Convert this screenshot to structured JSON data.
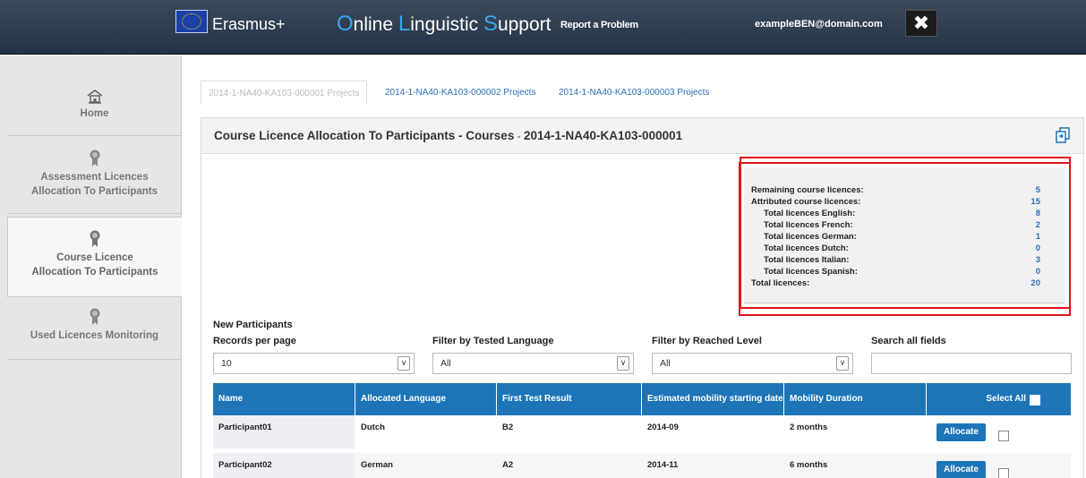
{
  "header": {
    "brand": "Erasmus+",
    "ols_caps": [
      "O",
      "L",
      "S"
    ],
    "ols_rest": [
      "nline ",
      "inguistic ",
      "upport"
    ],
    "report_link": "Report a Problem",
    "user_email": "exampleBEN@domain.com",
    "close_glyph": "✖"
  },
  "sidebar": {
    "items": [
      {
        "label1": "Home",
        "label2": "",
        "icon": "home-icon",
        "active": false
      },
      {
        "label1": "Assessment Licences",
        "label2": "Allocation To Participants",
        "icon": "award-icon",
        "active": false
      },
      {
        "label1": "Course Licence",
        "label2": "Allocation To Participants",
        "icon": "award-icon",
        "active": true
      },
      {
        "label1": "Used Licences Monitoring",
        "label2": "",
        "icon": "award-icon",
        "active": false
      }
    ]
  },
  "tabs": [
    {
      "label": "2014-1-NA40-KA103-000001 Projects",
      "active": true
    },
    {
      "label": "2014-1-NA40-KA103-000002 Projects",
      "active": false
    },
    {
      "label": "2014-1-NA40-KA103-000003 Projects",
      "active": false
    }
  ],
  "panel": {
    "title": "Course Licence Allocation To Participants - Courses",
    "title_sep": " - ",
    "project": "2014-1-NA40-KA103-000001",
    "export_icon": "export-icon"
  },
  "summary": {
    "rows": [
      {
        "label": "Remaining course licences:",
        "value": "5",
        "indent": false
      },
      {
        "label": "Attributed course licences:",
        "value": "15",
        "indent": false
      },
      {
        "label": "Total licences English:",
        "value": "8",
        "indent": true
      },
      {
        "label": "Total licences French:",
        "value": "2",
        "indent": true
      },
      {
        "label": "Total licences German:",
        "value": "1",
        "indent": true
      },
      {
        "label": "Total licences Dutch:",
        "value": "0",
        "indent": true
      },
      {
        "label": "Total licences Italian:",
        "value": "3",
        "indent": true
      },
      {
        "label": "Total licences Spanish:",
        "value": "0",
        "indent": true
      },
      {
        "label": "Total licences:",
        "value": "20",
        "indent": false
      }
    ]
  },
  "filters": {
    "section_title": "New Participants",
    "records_label": "Records per page",
    "records_value": "10",
    "tested_label": "Filter by Tested Language",
    "tested_value": "All",
    "reached_label": "Filter by Reached Level",
    "reached_value": "All",
    "search_label": "Search all fields",
    "search_value": ""
  },
  "table": {
    "columns": [
      "Name",
      "Allocated Language",
      "First Test Result",
      "Estimated mobility starting date",
      "Mobility Duration",
      "Select All"
    ],
    "rows": [
      {
        "name": "Participant01",
        "language": "Dutch",
        "result": "B2",
        "start": "2014-09",
        "duration": "2 months",
        "action": "Allocate"
      },
      {
        "name": "Participant02",
        "language": "German",
        "result": "A2",
        "start": "2014-11",
        "duration": "6 months",
        "action": "Allocate"
      }
    ]
  }
}
